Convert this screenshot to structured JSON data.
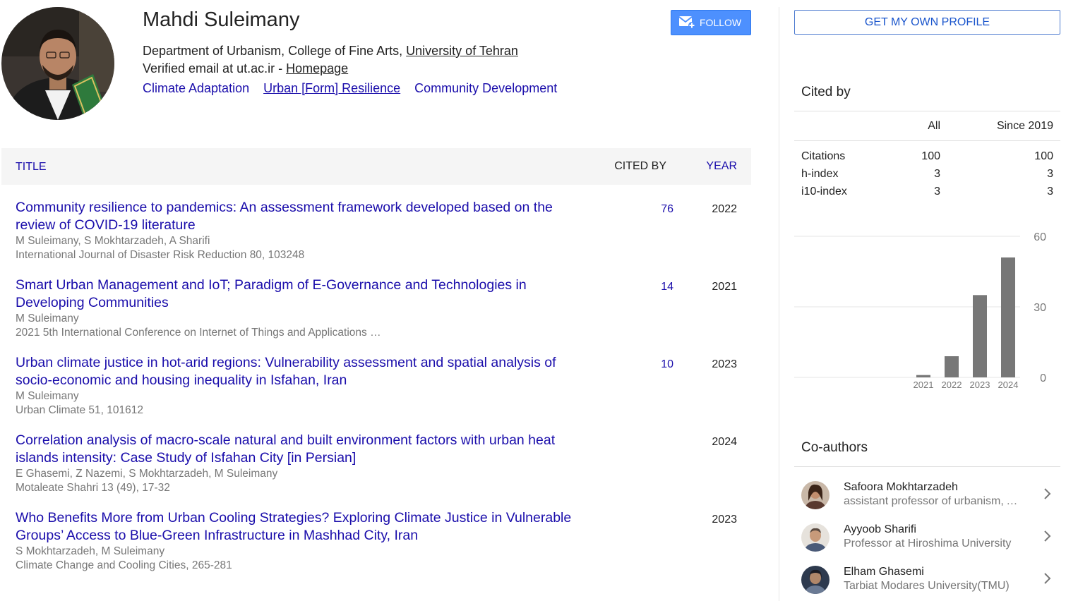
{
  "profile": {
    "name": "Mahdi Suleimany",
    "affiliation_prefix": "Department of Urbanism, College of Fine Arts, ",
    "affiliation_link": "University of Tehran",
    "email_text": "Verified email at ut.ac.ir - ",
    "homepage_label": "Homepage",
    "interests": [
      "Climate Adaptation",
      "Urban [Form] Resilience",
      "Community Development"
    ],
    "follow_label": "FOLLOW"
  },
  "table": {
    "col_title": "TITLE",
    "col_cited": "CITED BY",
    "col_year": "YEAR",
    "rows": [
      {
        "title": "Community resilience to pandemics: An assessment framework developed based on the review of COVID-19 literature",
        "authors": "M Suleimany, S Mokhtarzadeh, A Sharifi",
        "venue": "International Journal of Disaster Risk Reduction 80, 103248",
        "cited": "76",
        "year": "2022"
      },
      {
        "title": "Smart Urban Management and IoT; Paradigm of E-Governance and Technologies in Developing Communities",
        "authors": "M Suleimany",
        "venue": "2021 5th International Conference on Internet of Things and Applications …",
        "cited": "14",
        "year": "2021"
      },
      {
        "title": "Urban climate justice in hot-arid regions: Vulnerability assessment and spatial analysis of socio-economic and housing inequality in Isfahan, Iran",
        "authors": "M Suleimany",
        "venue": "Urban Climate 51, 101612",
        "cited": "10",
        "year": "2023"
      },
      {
        "title": "Correlation analysis of macro-scale natural and built environment factors with urban heat islands intensity: Case Study of Isfahan City [in Persian]",
        "authors": "E Ghasemi, Z Nazemi, S Mokhtarzadeh, M Suleimany",
        "venue": "Motaleate Shahri 13 (49), 17-32",
        "cited": "",
        "year": "2024"
      },
      {
        "title": "Who Benefits More from Urban Cooling Strategies? Exploring Climate Justice in Vulnerable Groups’ Access to Blue-Green Infrastructure in Mashhad City, Iran",
        "authors": "S Mokhtarzadeh, M Suleimany",
        "venue": "Climate Change and Cooling Cities, 265-281",
        "cited": "",
        "year": "2023"
      }
    ]
  },
  "sidebar": {
    "profile_button": "GET MY OWN PROFILE",
    "cited_by_title": "Cited by",
    "col_all": "All",
    "col_since": "Since 2019",
    "stats": [
      {
        "label": "Citations",
        "all": "100",
        "since": "100"
      },
      {
        "label": "h-index",
        "all": "3",
        "since": "3"
      },
      {
        "label": "i10-index",
        "all": "3",
        "since": "3"
      }
    ],
    "coauthors_title": "Co-authors",
    "coauthors": [
      {
        "name": "Safoora Mokhtarzadeh",
        "affiliation": "assistant professor of urbanism, Art University of Isfahan"
      },
      {
        "name": "Ayyoob Sharifi",
        "affiliation": "Professor at Hiroshima University"
      },
      {
        "name": "Elham Ghasemi",
        "affiliation": "Tarbiat Modares University(TMU)"
      }
    ]
  },
  "chart_data": {
    "type": "bar",
    "categories": [
      "2021",
      "2022",
      "2023",
      "2024"
    ],
    "values": [
      1,
      9,
      35,
      51
    ],
    "ylim": [
      0,
      60
    ],
    "yticks": [
      "60",
      "30",
      "0"
    ],
    "bar_color": "#777777"
  }
}
